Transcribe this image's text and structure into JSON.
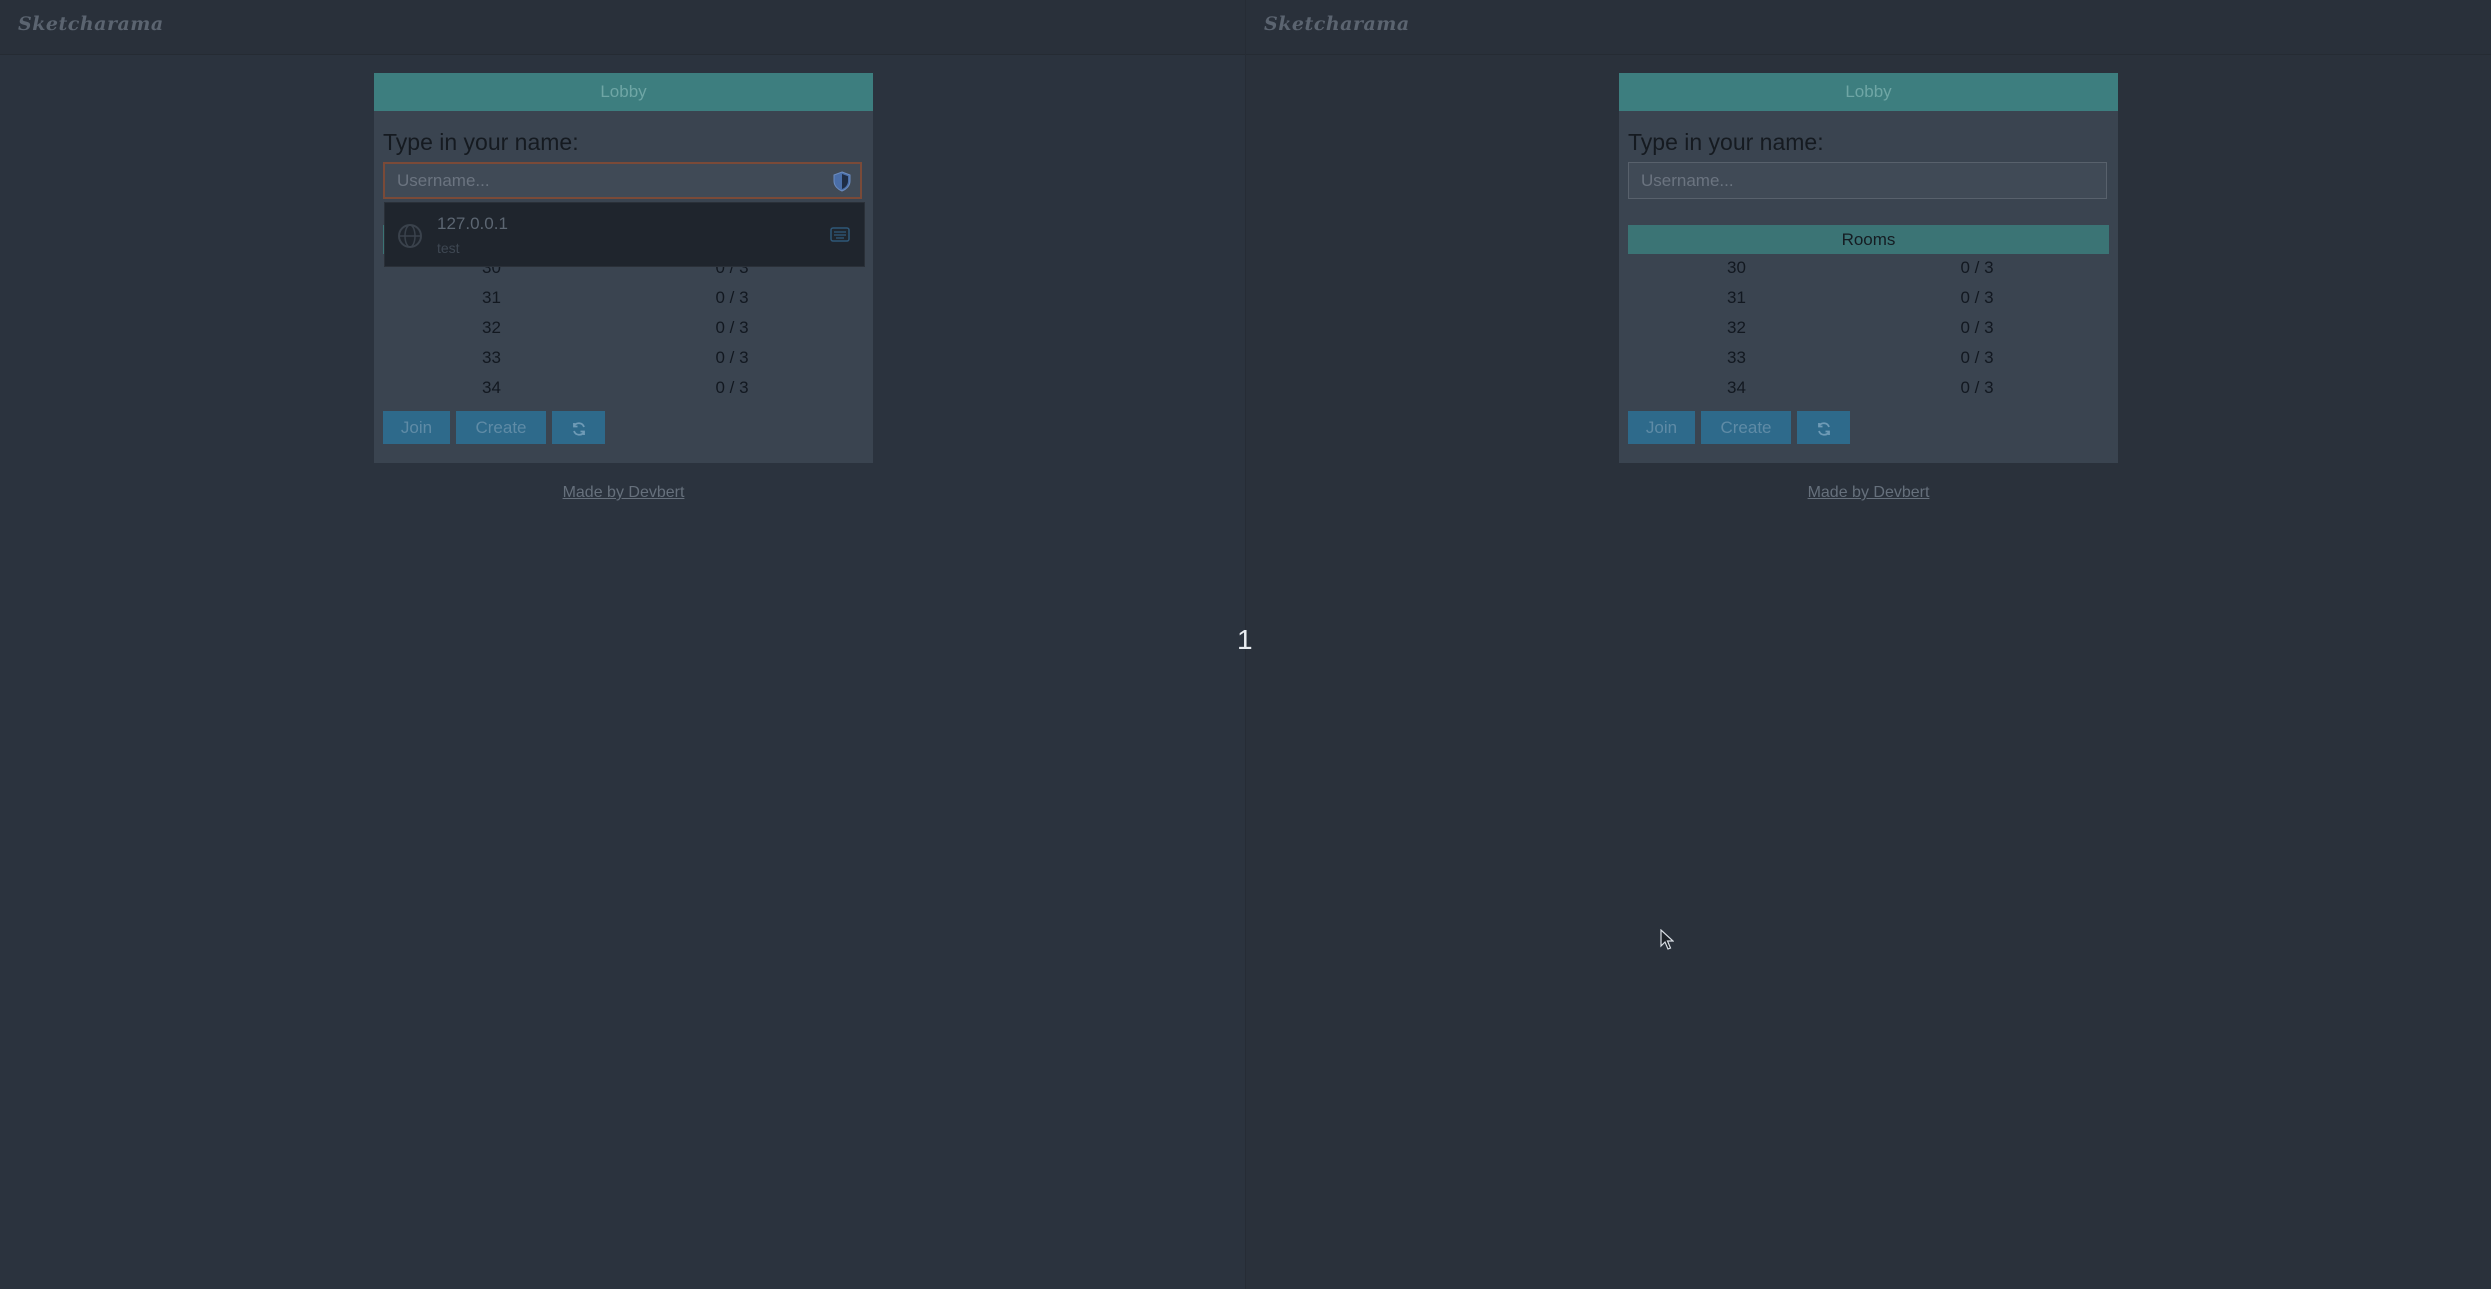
{
  "app": {
    "logo": "Sketcharama"
  },
  "lobby": {
    "header": "Lobby",
    "prompt": "Type in your name:",
    "username_placeholder": "Username...",
    "rooms_header": "Rooms",
    "rooms": [
      {
        "id": "30",
        "players": "0 / 3"
      },
      {
        "id": "31",
        "players": "0 / 3"
      },
      {
        "id": "32",
        "players": "0 / 3"
      },
      {
        "id": "33",
        "players": "0 / 3"
      },
      {
        "id": "34",
        "players": "0 / 3"
      }
    ],
    "join_label": "Join",
    "create_label": "Create",
    "refresh_icon": "refresh-icon"
  },
  "footer": {
    "credit": "Made by Devbert"
  },
  "autofill": {
    "host": "127.0.0.1",
    "username": "test",
    "icon": "globe-icon",
    "action_icon": "keyboard-icon"
  },
  "overlay": {
    "counter": "1"
  },
  "colors": {
    "teal_header": "#3d7e7f",
    "button_blue": "#2e6a8b",
    "background": "#2b333e"
  }
}
